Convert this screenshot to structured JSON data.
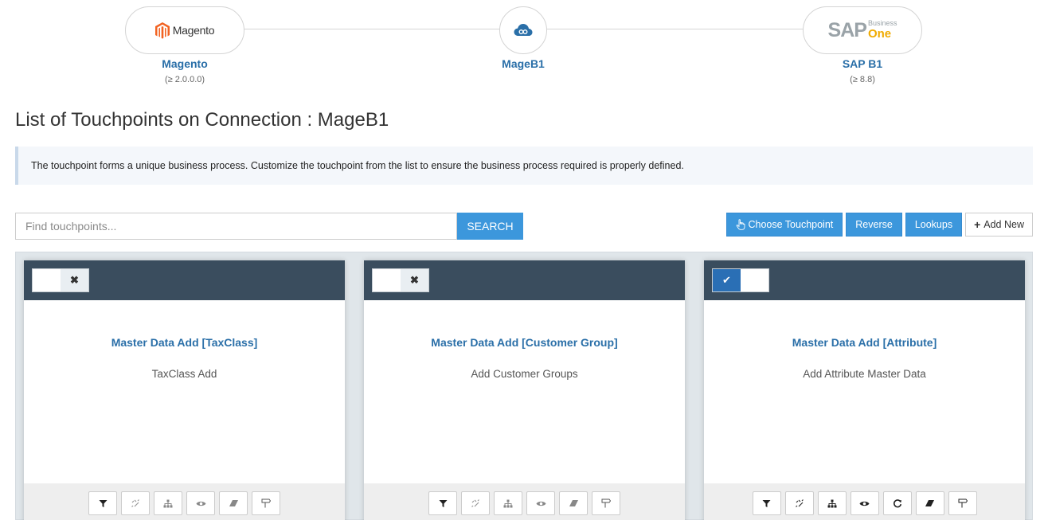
{
  "connection": {
    "source": {
      "label": "Magento",
      "version": "(≥ 2.0.0.0)",
      "logo_text": "Magento"
    },
    "middle": {
      "label": "MageB1"
    },
    "target": {
      "label": "SAP B1",
      "version": "(≥ 8.8)",
      "logo_main": "SAP",
      "logo_business": "Business",
      "logo_one": "One"
    }
  },
  "page": {
    "title": "List of Touchpoints on Connection : MageB1"
  },
  "info": {
    "text": "The touchpoint forms a unique business process. Customize the touchpoint from the list to ensure the business process required is properly defined."
  },
  "search": {
    "placeholder": "Find touchpoints...",
    "button_label": "SEARCH"
  },
  "actions": {
    "choose_touchpoint": "Choose Touchpoint",
    "reverse": "Reverse",
    "lookups": "Lookups",
    "add_new": "Add New"
  },
  "cards": [
    {
      "title": "Master Data Add [TaxClass]",
      "description": "TaxClass Add",
      "enabled": false
    },
    {
      "title": "Master Data Add [Customer Group]",
      "description": "Add Customer Groups",
      "enabled": false
    },
    {
      "title": "Master Data Add [Attribute]",
      "description": "Add Attribute Master Data",
      "enabled": true
    }
  ],
  "colors": {
    "accent": "#3c97dc",
    "card_header": "#3a4d5e",
    "link": "#2a6fa8",
    "magento_orange": "#f26322",
    "sap_gold": "#f0ab00"
  }
}
